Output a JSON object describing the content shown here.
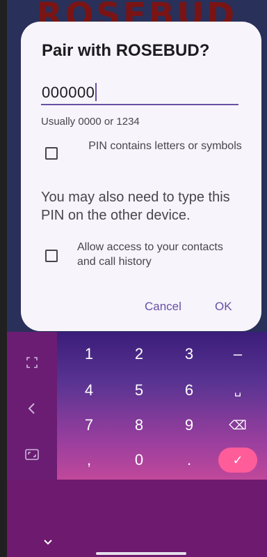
{
  "background_app": {
    "title": "ROSEBUD"
  },
  "dialog": {
    "title": "Pair with ROSEBUD?",
    "pin_value": "000000",
    "pin_hint": "Usually 0000 or 1234",
    "checkbox_letters_label": "PIN contains letters or symbols",
    "notice": "You may also need to type this PIN on the other device.",
    "checkbox_contacts_label": "Allow access to your contacts and call history",
    "cancel_label": "Cancel",
    "ok_label": "OK"
  },
  "keyboard": {
    "rows": [
      [
        "1",
        "2",
        "3",
        "–"
      ],
      [
        "4",
        "5",
        "6",
        "␣"
      ],
      [
        "7",
        "8",
        "9",
        "⌫"
      ],
      [
        ",",
        "0",
        ".",
        "✓"
      ]
    ],
    "side_icons": [
      "expand-icon",
      "back-arrow-icon",
      "resize-icon"
    ],
    "collapse_icon": "chevron-down-icon"
  },
  "colors": {
    "accent": "#6750a4",
    "enter_key": "#ff5c9a",
    "keyboard_bg": "#6a1d73"
  }
}
